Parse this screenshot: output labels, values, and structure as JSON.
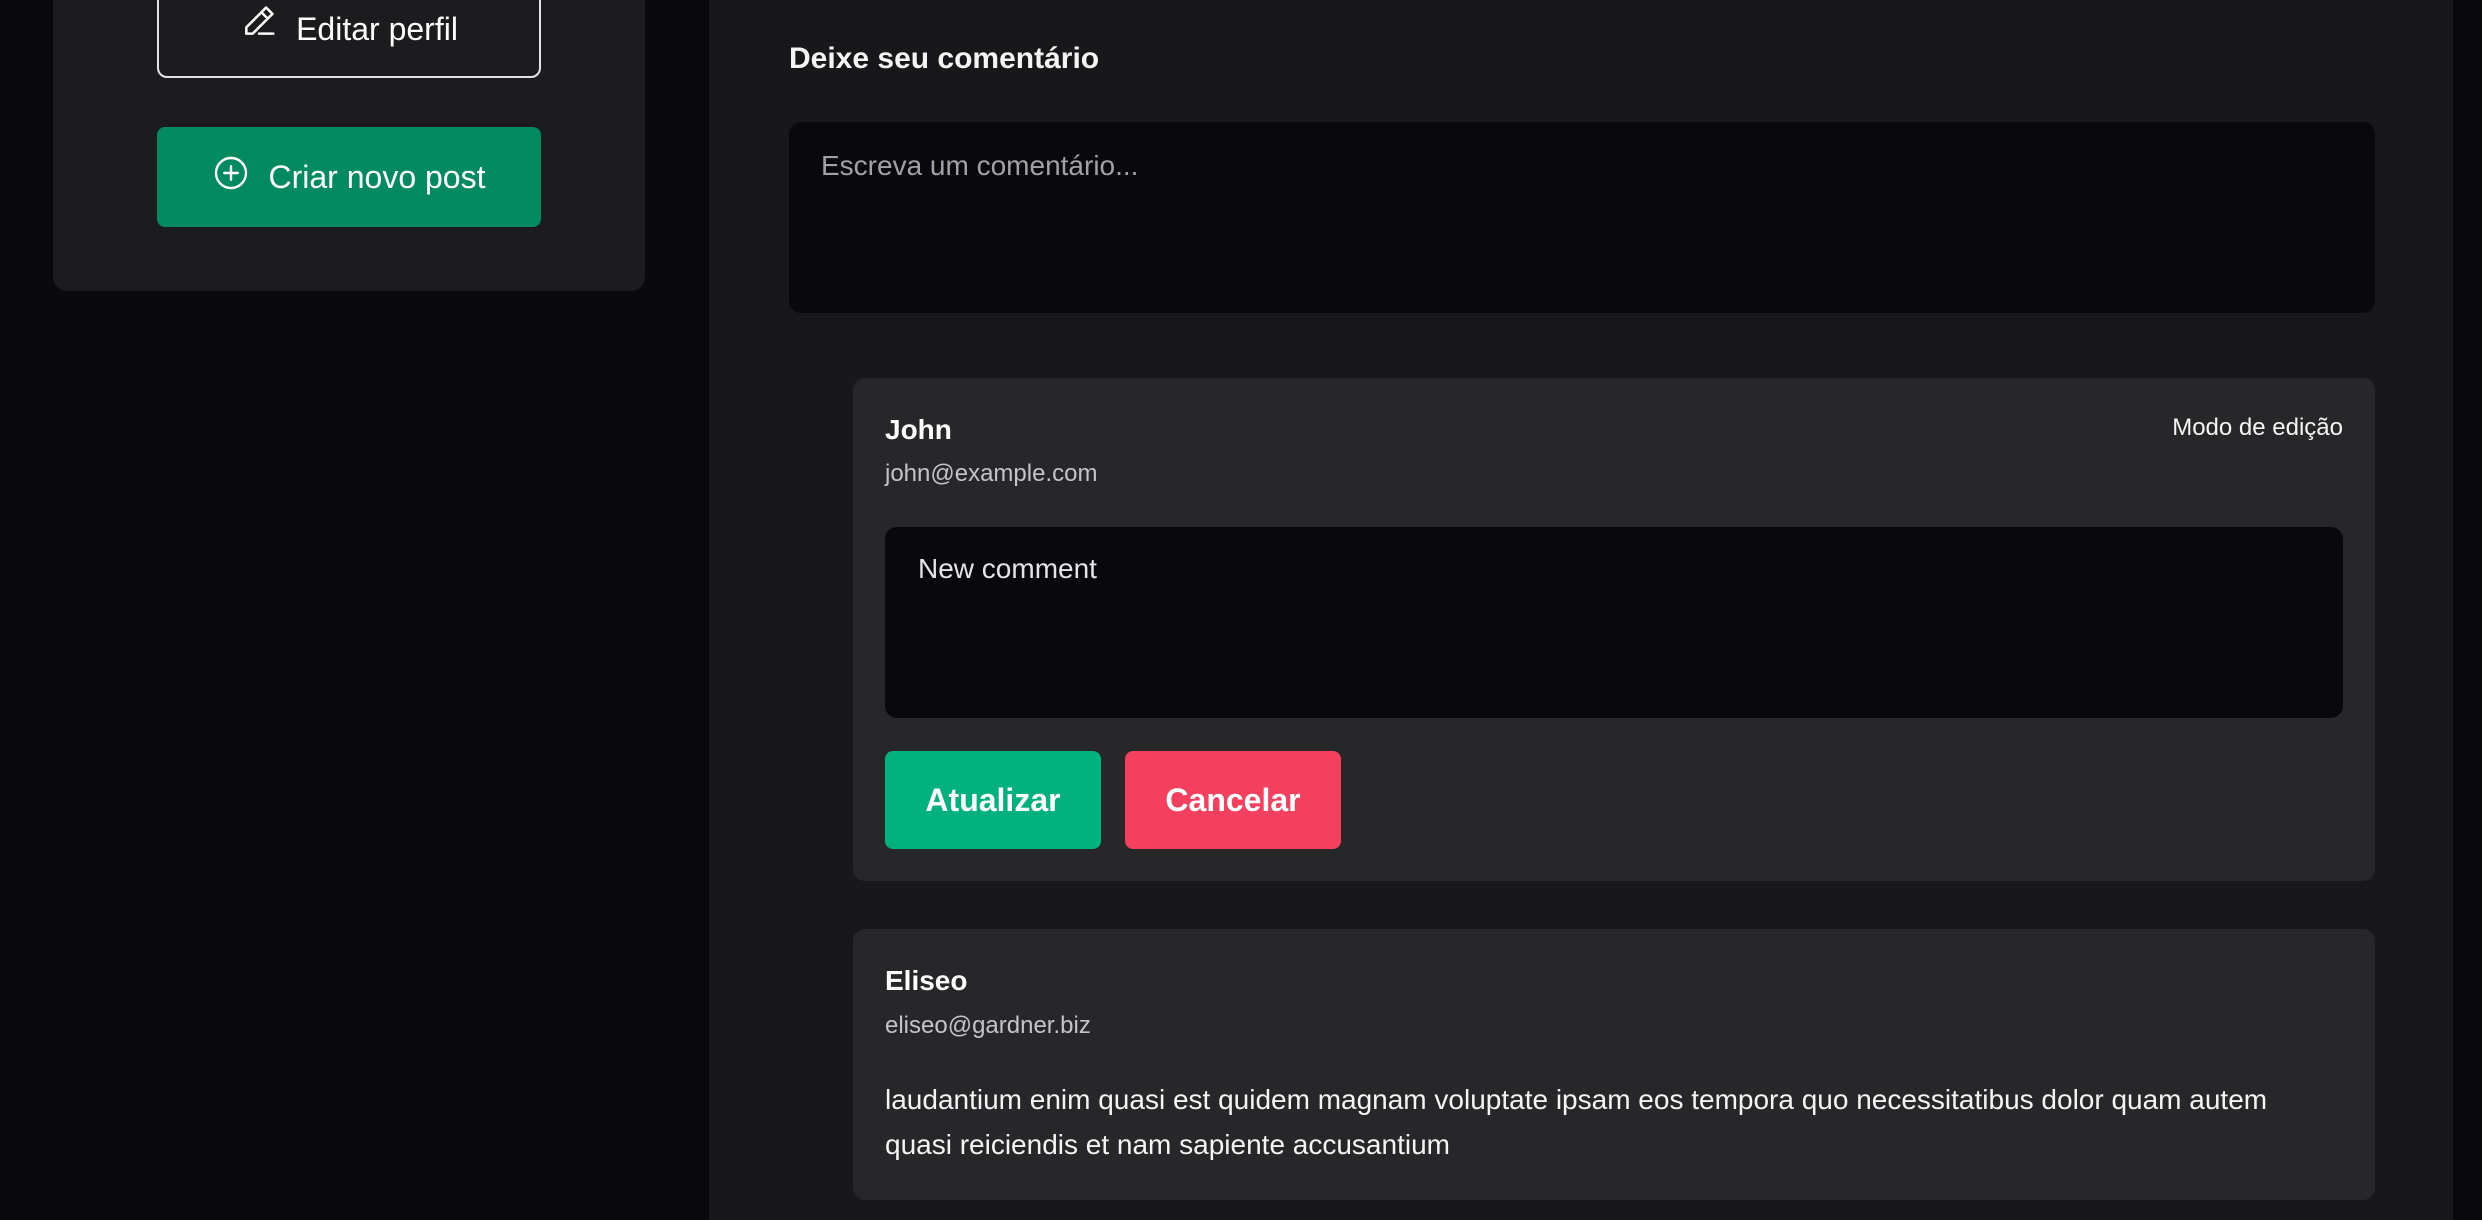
{
  "sidebar": {
    "edit_profile_label": "Editar perfil",
    "create_post_label": "Criar novo post"
  },
  "comments_section": {
    "title": "Deixe seu comentário",
    "input_placeholder": "Escreva um comentário..."
  },
  "comments": [
    {
      "author": "John",
      "email": "john@example.com",
      "mode_label": "Modo de edição",
      "edit_value": "New comment",
      "update_label": "Atualizar",
      "cancel_label": "Cancelar"
    },
    {
      "author": "Eliseo",
      "email": "eliseo@gardner.biz",
      "body": "laudantium enim quasi est quidem magnam voluptate ipsam eos tempora quo necessitatibus dolor quam autem quasi reiciendis et nam sapiente accusantium"
    }
  ],
  "icons": {
    "edit": "pencil-icon",
    "create": "plus-circle-icon"
  },
  "colors": {
    "create_button": "#038a5f",
    "update_button": "#02b27e",
    "cancel_button": "#f43f5e"
  }
}
